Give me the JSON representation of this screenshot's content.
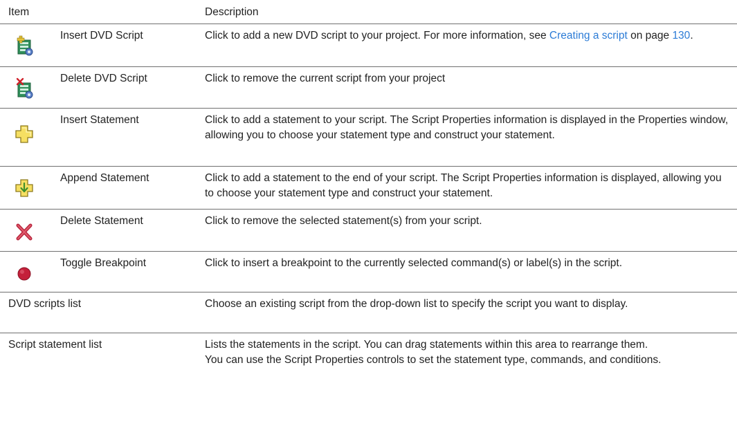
{
  "header": {
    "item": "Item",
    "description": "Description"
  },
  "rows": [
    {
      "label": "Insert DVD Script",
      "icon": "insert-dvd-script-icon",
      "desc_a": "Click to add a new DVD script to your project. For more information, see ",
      "link_a": "Creating a script",
      "desc_b": " on page ",
      "link_b": "130",
      "desc_c": "."
    },
    {
      "label": "Delete DVD Script",
      "icon": "delete-dvd-script-icon",
      "desc": "Click to remove the current script from your project"
    },
    {
      "label": "Insert Statement",
      "icon": "insert-statement-icon",
      "desc": "Click to add a statement to your script. The Script Properties information is displayed in the Properties window, allowing you to choose your statement type and construct your statement."
    },
    {
      "label": "Append Statement",
      "icon": "append-statement-icon",
      "desc": "Click to add a statement to the end of your script. The Script Properties information is displayed, allowing you to choose your statement type and construct your statement."
    },
    {
      "label": "Delete Statement",
      "icon": "delete-statement-icon",
      "desc": "Click to remove the selected statement(s) from your script."
    },
    {
      "label": "Toggle Breakpoint",
      "icon": "breakpoint-icon",
      "desc": "Click to insert a breakpoint to the currently selected command(s) or label(s) in the script."
    },
    {
      "label": "DVD scripts list",
      "desc": "Choose an existing script from the drop-down list to specify the script you want to display."
    },
    {
      "label": "Script statement list",
      "desc": "Lists the statements in the script. You can drag statements within this area to rearrange them.",
      "desc2": "You can use the Script Properties controls to set the statement type, commands, and conditions."
    }
  ],
  "colors": {
    "link": "#2b7bd6",
    "rule": "#6f6f6f",
    "text": "#222222"
  }
}
